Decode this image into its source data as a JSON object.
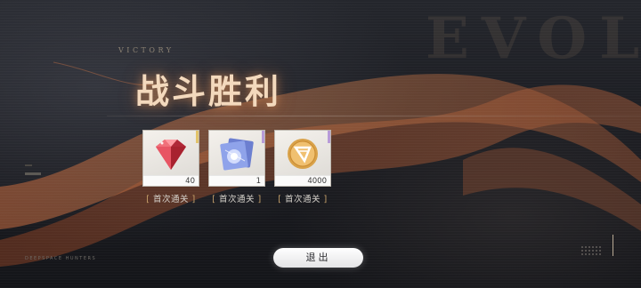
{
  "background_word": "EVOL",
  "victory_label": "VICTORY",
  "title": "战斗胜利",
  "rewards": [
    {
      "icon": "red-gem-icon",
      "quantity": "40",
      "tag": "首次通关"
    },
    {
      "icon": "blue-card-icon",
      "quantity": "1",
      "tag": "首次通关"
    },
    {
      "icon": "gold-coin-icon",
      "quantity": "4000",
      "tag": "首次通关"
    }
  ],
  "exit_button": "退出",
  "corner_caption": "DEEPSPACE HUNTERS",
  "colors": {
    "title_glow": "#f3d9bd",
    "ribbon": "#b8643c",
    "button": "#ffffff",
    "rarity_gold": "#e2c36a",
    "rarity_purple": "#b79bd8"
  }
}
